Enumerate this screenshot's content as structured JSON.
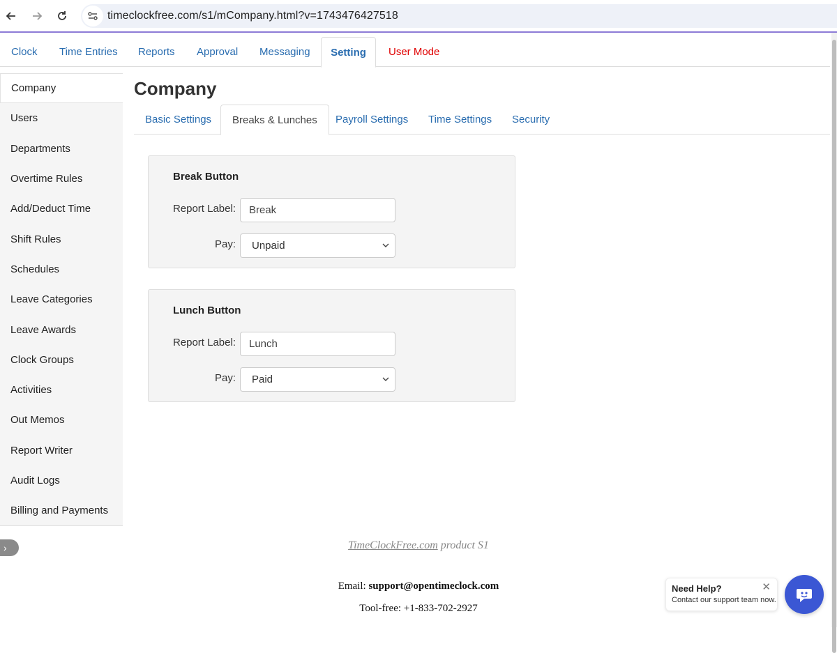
{
  "browser": {
    "url": "timeclockfree.com/s1/mCompany.html?v=1743476427518"
  },
  "topmenu": {
    "tabs": [
      {
        "label": "Clock"
      },
      {
        "label": "Time Entries"
      },
      {
        "label": "Reports"
      },
      {
        "label": "Approval"
      },
      {
        "label": "Messaging"
      },
      {
        "label": "Setting",
        "active": true
      },
      {
        "label": "User Mode",
        "color": "#e00000"
      }
    ]
  },
  "sidebar": {
    "items": [
      {
        "label": "Company",
        "active": true
      },
      {
        "label": "Users"
      },
      {
        "label": "Departments"
      },
      {
        "label": "Overtime Rules"
      },
      {
        "label": "Add/Deduct Time"
      },
      {
        "label": "Shift Rules"
      },
      {
        "label": "Schedules"
      },
      {
        "label": "Leave Categories"
      },
      {
        "label": "Leave Awards"
      },
      {
        "label": "Clock Groups"
      },
      {
        "label": "Activities"
      },
      {
        "label": "Out Memos"
      },
      {
        "label": "Report Writer"
      },
      {
        "label": "Audit Logs"
      },
      {
        "label": "Billing and Payments"
      }
    ]
  },
  "main": {
    "title": "Company",
    "subtabs": [
      {
        "label": "Basic Settings"
      },
      {
        "label": "Breaks & Lunches",
        "active": true
      },
      {
        "label": "Payroll Settings"
      },
      {
        "label": "Time Settings"
      },
      {
        "label": "Security"
      }
    ],
    "break_panel": {
      "title": "Break Button",
      "report_label_text": "Report Label:",
      "report_label_value": "Break",
      "pay_text": "Pay:",
      "pay_value": "Unpaid"
    },
    "lunch_panel": {
      "title": "Lunch Button",
      "report_label_text": "Report Label:",
      "report_label_value": "Lunch",
      "pay_text": "Pay:",
      "pay_value": "Paid"
    }
  },
  "footer": {
    "product_link": "TimeClockFree.com",
    "product_suffix": " product S1",
    "email_label": "Email: ",
    "email_value": "support@opentimeclock.com",
    "phone_label": "Tool-free: ",
    "phone_value": "+1-833-702-2927"
  },
  "help": {
    "title": "Need Help?",
    "subtitle": "Contact our support team now.",
    "close_glyph": "✕"
  },
  "colors": {
    "link": "#2a6db0",
    "user_mode": "#e00000",
    "chat_button": "#3b57d4",
    "accent_line": "#8c7bd6"
  }
}
